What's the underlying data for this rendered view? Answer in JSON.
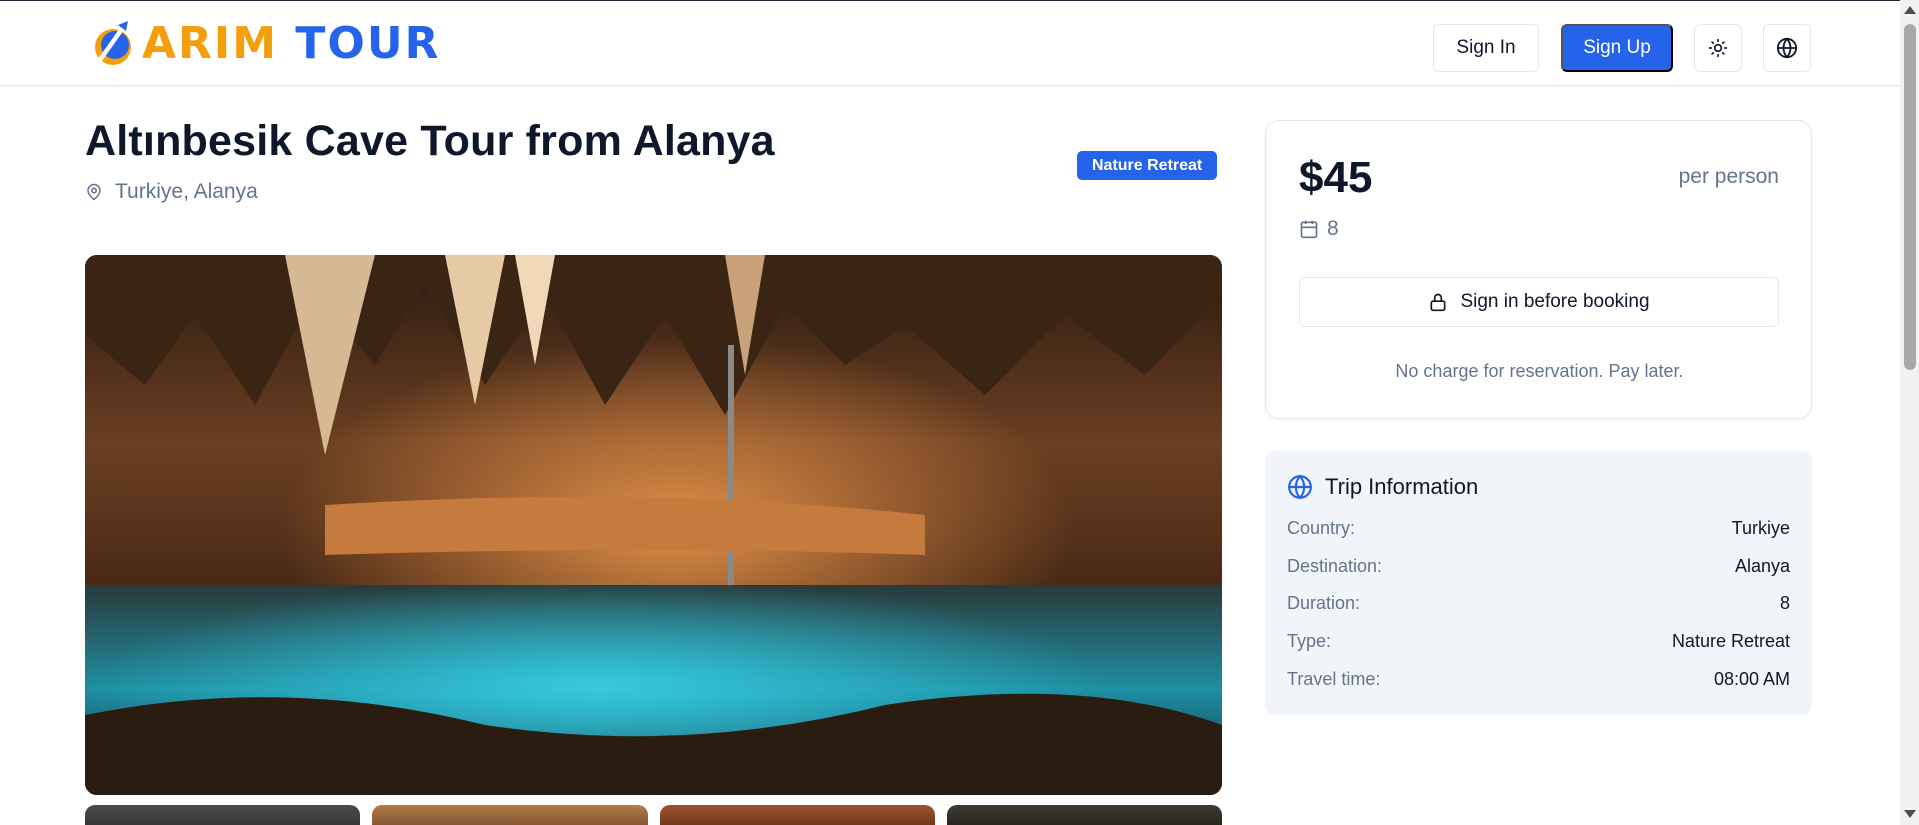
{
  "header": {
    "logo_text_part1": "ARIM",
    "logo_text_part2": "TOUR",
    "signin_label": "Sign In",
    "signup_label": "Sign Up",
    "theme_icon": "sun-icon",
    "language_icon": "globe-icon"
  },
  "tour": {
    "title": "Altınbesik Cave Tour from Alanya",
    "location": "Turkiye, Alanya",
    "tag": "Nature Retreat",
    "hero_image": "cave-photo",
    "thumbnails_count": 4
  },
  "booking": {
    "price": "$45",
    "per": "per person",
    "duration": "8",
    "button_label": "Sign in before booking",
    "note": "No charge for reservation. Pay later."
  },
  "trip_info": {
    "heading": "Trip Information",
    "rows": [
      {
        "label": "Country:",
        "value": "Turkiye"
      },
      {
        "label": "Destination:",
        "value": "Alanya"
      },
      {
        "label": "Duration:",
        "value": "8"
      },
      {
        "label": "Type:",
        "value": "Nature Retreat"
      },
      {
        "label": "Travel time:",
        "value": "08:00 AM"
      }
    ]
  },
  "colors": {
    "primary": "#2563eb",
    "accent": "#f59e0b",
    "muted": "#64748b"
  }
}
